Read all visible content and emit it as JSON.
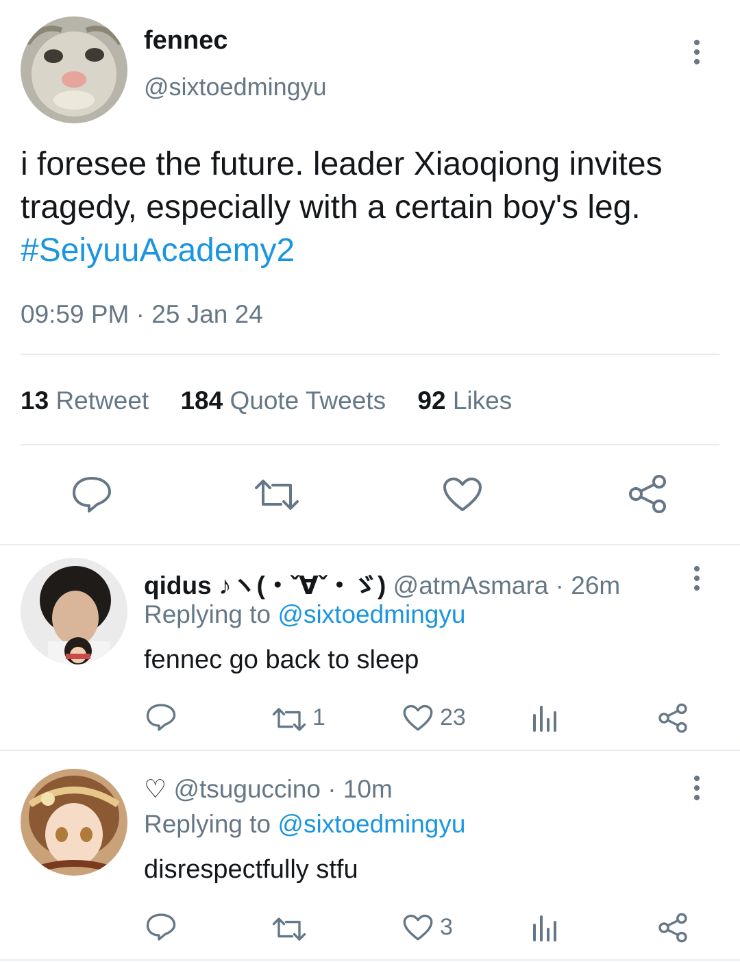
{
  "tweet": {
    "display_name": "fennec",
    "handle": "@sixtoedmingyu",
    "text": "i foresee the future. leader Xiaoqiong invites tragedy, especially with a certain boy's leg.",
    "hashtag": "#SeiyuuAcademy2",
    "time": "09:59 PM",
    "separator": "·",
    "date": "25 Jan 24",
    "stats": {
      "retweets_count": "13",
      "retweets_label": "Retweet",
      "quotes_count": "184",
      "quotes_label": "Quote Tweets",
      "likes_count": "92",
      "likes_label": "Likes"
    }
  },
  "replies": [
    {
      "display_name": "qidus ♪ヽ(・ˇ∀ˇ・ゞ)",
      "handle": "@atmAsmara",
      "time": "· 26m",
      "replying_label": "Replying to",
      "replying_handle": "@sixtoedmingyu",
      "text": "fennec go back to sleep",
      "retweets": "1",
      "likes": "23"
    },
    {
      "display_name": "♡",
      "handle": "@tsuguccino",
      "time": "· 10m",
      "replying_label": "Replying to",
      "replying_handle": "@sixtoedmingyu",
      "text": "disrespectfully stfu",
      "retweets": "",
      "likes": "3"
    }
  ],
  "colors": {
    "text": "#14171a",
    "secondary": "#657786",
    "link": "#1b95e0",
    "divider": "#e6ecf0"
  },
  "icons": [
    "more-vertical-icon",
    "reply-icon",
    "retweet-icon",
    "like-icon",
    "share-icon",
    "analytics-icon"
  ]
}
